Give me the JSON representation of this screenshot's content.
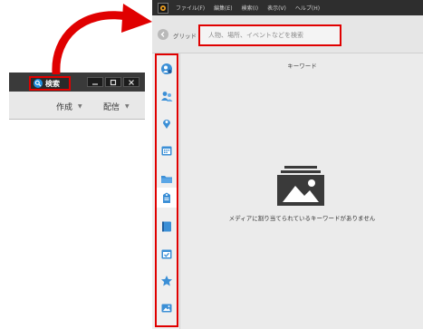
{
  "inset": {
    "search_label": "検索",
    "menu": [
      {
        "label": "作成",
        "caret": "▼"
      },
      {
        "label": "配信",
        "caret": "▼"
      }
    ],
    "window_controls": [
      "minimize-icon",
      "maximize-icon",
      "close-icon"
    ]
  },
  "app": {
    "menubar": [
      "ファイル(F)",
      "編集(E)",
      "検索(I)",
      "表示(V)",
      "ヘルプ(H)"
    ],
    "toolbar": {
      "grid_label": "グリッド",
      "search_placeholder": "人物、場所、イベントなどを検索"
    },
    "sidebar": [
      {
        "id": "people-tag",
        "icon": "person-tag-icon",
        "color": "#3b8fd6"
      },
      {
        "id": "people",
        "icon": "people-icon",
        "color": "#3b8fd6"
      },
      {
        "id": "places",
        "icon": "map-pin-icon",
        "color": "#3b8fd6"
      },
      {
        "id": "dates",
        "icon": "calendar-icon",
        "color": "#3b8fd6"
      },
      {
        "id": "folders",
        "icon": "folder-icon",
        "color": "#3b8fd6"
      },
      {
        "id": "keywords",
        "icon": "keyword-tag-icon",
        "color": "#3b8fd6",
        "active": true
      },
      {
        "id": "albums",
        "icon": "album-icon",
        "color": "#3b8fd6"
      },
      {
        "id": "events",
        "icon": "event-calendar-icon",
        "color": "#3b8fd6"
      },
      {
        "id": "ratings",
        "icon": "star-icon",
        "color": "#3b8fd6"
      },
      {
        "id": "media",
        "icon": "image-icon",
        "color": "#3b8fd6"
      }
    ],
    "content": {
      "title": "キーワード",
      "empty_message": "メディアに割り当てられているキーワードがありません"
    }
  },
  "colors": {
    "highlight": "#e00000",
    "accent": "#3b8fd6"
  }
}
